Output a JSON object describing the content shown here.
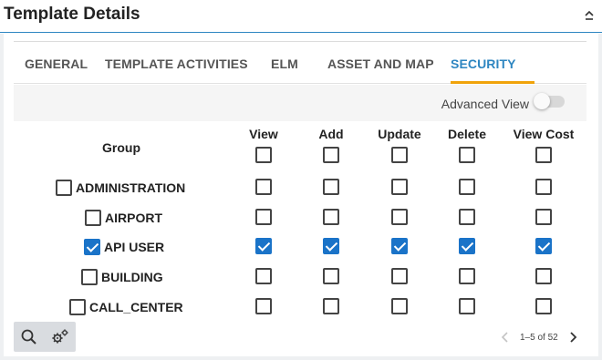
{
  "panel": {
    "title": "Template Details"
  },
  "tabs": [
    {
      "label": "GENERAL",
      "active": false
    },
    {
      "label": "TEMPLATE ACTIVITIES",
      "active": false
    },
    {
      "label": "ELM",
      "active": false
    },
    {
      "label": "ASSET AND MAP",
      "active": false
    },
    {
      "label": "SECURITY",
      "active": true
    }
  ],
  "advanced_view": {
    "label": "Advanced View",
    "enabled": false
  },
  "table": {
    "group_header": "Group",
    "columns": [
      "View",
      "Add",
      "Update",
      "Delete",
      "View Cost"
    ],
    "header_checks": [
      false,
      false,
      false,
      false,
      false
    ],
    "rows": [
      {
        "label": "ADMINISTRATION",
        "selected": false,
        "checks": [
          false,
          false,
          false,
          false,
          false
        ]
      },
      {
        "label": "AIRPORT",
        "selected": false,
        "checks": [
          false,
          false,
          false,
          false,
          false
        ]
      },
      {
        "label": "API USER",
        "selected": true,
        "checks": [
          true,
          true,
          true,
          true,
          true
        ]
      },
      {
        "label": "BUILDING",
        "selected": false,
        "checks": [
          false,
          false,
          false,
          false,
          false
        ]
      },
      {
        "label": "CALL_CENTER",
        "selected": false,
        "checks": [
          false,
          false,
          false,
          false,
          false
        ]
      }
    ]
  },
  "toolbar": {
    "search_icon": "search-icon",
    "settings_icon": "gears-icon"
  },
  "pager": {
    "text": "1–5 of 52"
  },
  "colors": {
    "accent": "#2e86c1",
    "tab_underline": "#f0a30a",
    "checkbox_checked": "#1a73c8"
  }
}
